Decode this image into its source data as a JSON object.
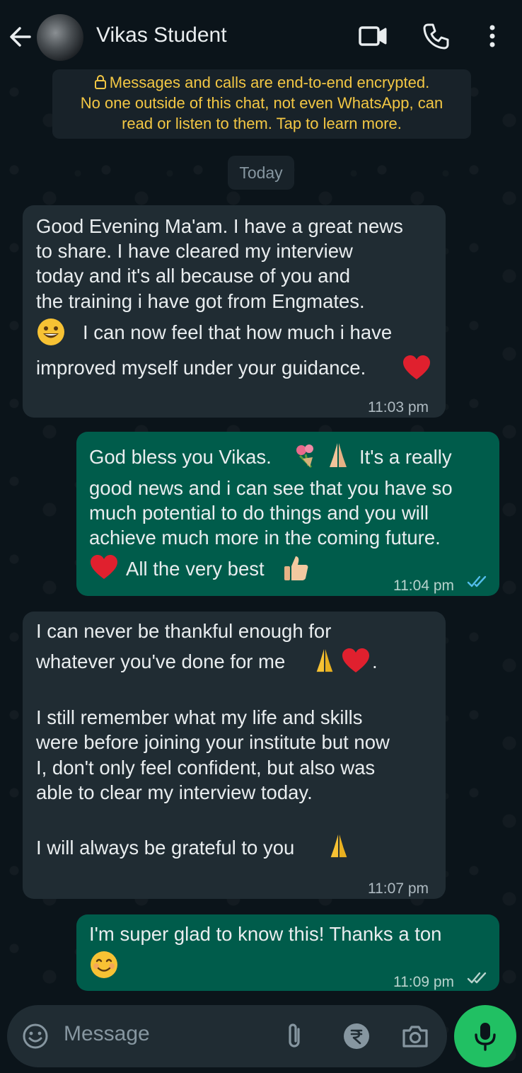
{
  "header": {
    "contact_name": "Vikas Student",
    "back_icon": "arrow-left-icon",
    "video_icon": "video-call-icon",
    "call_icon": "phone-icon",
    "menu_icon": "more-vertical-icon"
  },
  "encryption_notice": {
    "line1": "Messages and calls are end-to-end encrypted.",
    "line2": "No one outside of this chat, not even WhatsApp, can",
    "line3": "read or listen to them. Tap to learn more."
  },
  "date_separator": "Today",
  "messages": [
    {
      "direction": "incoming",
      "lines": [
        "Good Evening Ma'am. I have a great news",
        "to share. I have cleared my interview",
        "today and it's all because of you and",
        "the training i have got from Engmates.",
        "I can now feel that how much i have",
        "improved myself under your guidance."
      ],
      "time": "11:03 pm"
    },
    {
      "direction": "outgoing",
      "lines": [
        "God bless you Vikas.",
        "It's a really",
        "good news and i can see that you have so",
        "much potential to do things and you will",
        "achieve much more in the coming future.",
        "All the very best"
      ],
      "time": "11:04 pm",
      "status": "read"
    },
    {
      "direction": "incoming",
      "lines": [
        "I can never be thankful enough for",
        "whatever you've done for me",
        ".",
        "I still remember what my life and skills",
        "were before joining your institute but now",
        "I, don't only feel confident, but also was",
        "able to clear my interview today.",
        "I will always be grateful to you"
      ],
      "time": "11:07 pm"
    },
    {
      "direction": "outgoing",
      "lines": [
        "I'm super glad to know this! Thanks a ton"
      ],
      "time": "11:09 pm",
      "status": "delivered"
    }
  ],
  "composer": {
    "placeholder": "Message",
    "emoji_icon": "emoji-icon",
    "attach_icon": "paperclip-icon",
    "payment_icon": "rupee-icon",
    "camera_icon": "camera-icon",
    "mic_icon": "mic-icon"
  },
  "colors": {
    "background": "#0b141a",
    "incoming_bubble": "#202c33",
    "outgoing_bubble": "#005c4b",
    "accent_green": "#21c063",
    "read_tick": "#53bdeb",
    "notice_text": "#f3c744"
  }
}
